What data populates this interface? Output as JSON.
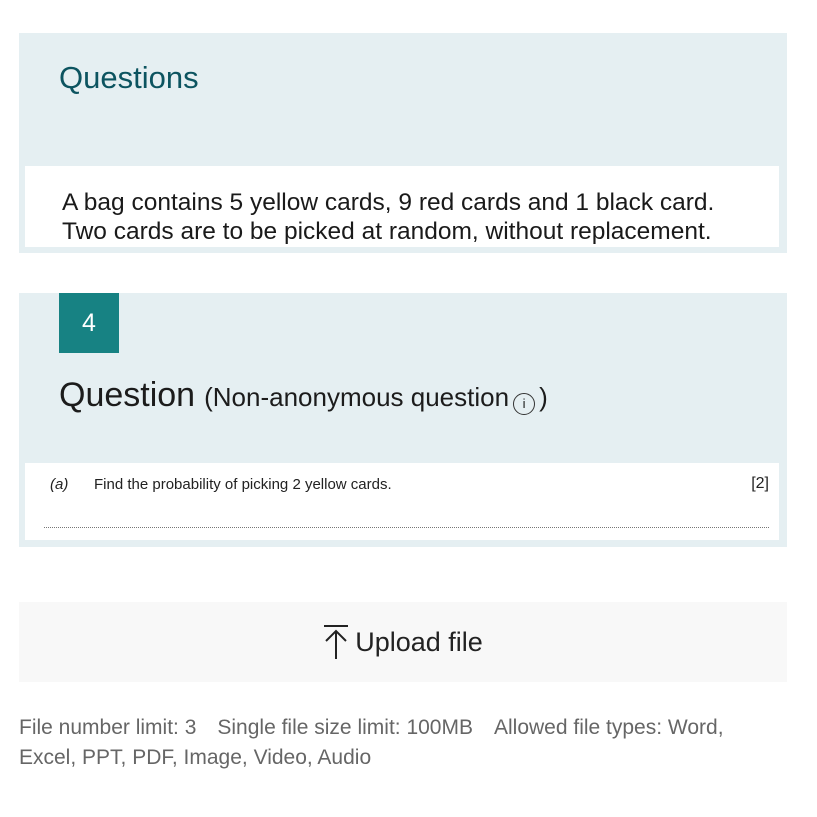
{
  "questions_section": {
    "title": "Questions",
    "prompt_line1": "A bag contains 5 yellow cards, 9 red cards and 1 black card.",
    "prompt_line2": "Two cards are to be picked at random, without replacement."
  },
  "question": {
    "number": "4",
    "label": "Question",
    "subtitle": "(Non-anonymous question",
    "info_glyph": "i",
    "close_paren": ")",
    "part_letter": "(a)",
    "part_text": "Find the probability of picking 2 yellow cards.",
    "marks": "[2]"
  },
  "upload": {
    "label": "Upload file",
    "icon": "upload-arrow-icon",
    "info_line": "File number limit: 3 Single file size limit: 100MB Allowed file types: Word, Excel, PPT, PDF, Image, Video, Audio"
  },
  "colors": {
    "card_background": "#e5eff2",
    "title_color": "#0c5460",
    "badge_background": "#178283",
    "upload_background": "#f8f8f8"
  }
}
